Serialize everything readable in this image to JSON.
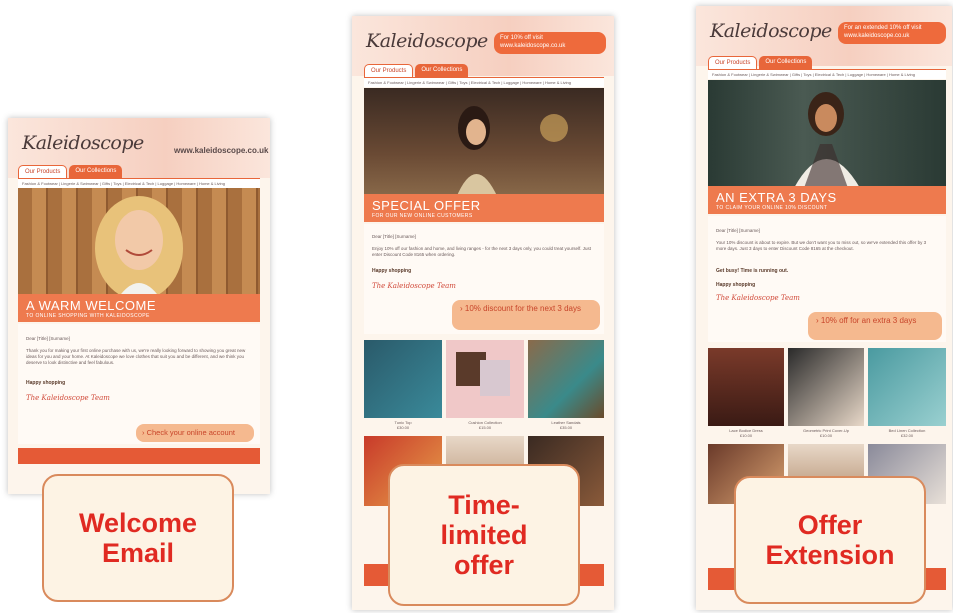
{
  "colors": {
    "accent": "#ee6a3c",
    "label_text": "#e02a22"
  },
  "email1": {
    "logo": "Kaleidoscope",
    "logo_sub": "",
    "url": "www.kaleidoscope.co.uk",
    "tabs": [
      "Our Products",
      "Our Collections"
    ],
    "nav": "Fashion & Footwear | Lingerie & Swimwear | Gifts | Toys | Electrical & Tech | Luggage | Homeware | Home & Living",
    "banner_title": "A WARM WELCOME",
    "banner_sub": "TO ONLINE SHOPPING WITH KALEIDOSCOPE",
    "greeting": "Dear [Title] [Surname]",
    "body": "Thank you for making your first online purchase with us, we're really looking forward to showing you great new ideas for you and your home. At Kaleidoscope we love clothes that suit you and be different, and we think you deserve to look distinctive and feel fabulous.",
    "happy": "Happy shopping",
    "signature": "The Kaleidoscope Team",
    "cta": "Check your online account"
  },
  "email2": {
    "logo": "Kaleidoscope",
    "pill_line1": "For 10% off visit",
    "pill_line2": "www.kaleidoscope.co.uk",
    "tabs": [
      "Our Products",
      "Our Collections"
    ],
    "nav": "Fashion & Footwear | Lingerie & Swimwear | Gifts | Toys | Electrical & Tech | Luggage | Homeware | Home & Living",
    "banner_title": "SPECIAL OFFER",
    "banner_sub": "FOR OUR NEW ONLINE CUSTOMERS",
    "greeting": "Dear [Title] [Surname]",
    "body": "Enjoy 10% off our fashion and home, and living ranges - for the next 3 days only, you could treat yourself. Just enter Discount Code 8165 when ordering.",
    "happy": "Happy shopping",
    "signature": "The Kaleidoscope Team",
    "cta": "10% discount for the next 3 days",
    "products": [
      {
        "name": "Tunic Top",
        "price": "£30.00"
      },
      {
        "name": "Cushion Collection",
        "price": "£15.00"
      },
      {
        "name": "Leather Sandals",
        "price": "£35.00"
      }
    ]
  },
  "email3": {
    "logo": "Kaleidoscope",
    "pill_line1": "For an extended 10% off visit",
    "pill_line2": "www.kaleidoscope.co.uk",
    "tabs": [
      "Our Products",
      "Our Collections"
    ],
    "nav": "Fashion & Footwear | Lingerie & Swimwear | Gifts | Toys | Electrical & Tech | Luggage | Homeware | Home & Living",
    "banner_title": "AN EXTRA 3 DAYS",
    "banner_sub": "TO CLAIM YOUR ONLINE 10% DISCOUNT",
    "greeting": "Dear [Title] [Surname]",
    "body": "Your 10% discount is about to expire. But we don't want you to miss out, so we've extended this offer by 3 more days. Just 3 days to enter Discount Code 8165 at the checkout.",
    "hurry": "Get busy! Time is running out.",
    "happy": "Happy shopping",
    "signature": "The Kaleidoscope Team",
    "cta": "10% off for an extra 3 days",
    "products": [
      {
        "name": "Lace Bodice Dress",
        "price": "£10.00"
      },
      {
        "name": "Geometric Print Cover-Up",
        "price": "£10.00"
      },
      {
        "name": "Bed Linen Collection",
        "price": "£32.00"
      }
    ]
  },
  "labels": {
    "welcome": [
      "Welcome",
      "Email"
    ],
    "limited": [
      "Time-",
      "limited",
      "offer"
    ],
    "extension": [
      "Offer",
      "Extension"
    ]
  }
}
